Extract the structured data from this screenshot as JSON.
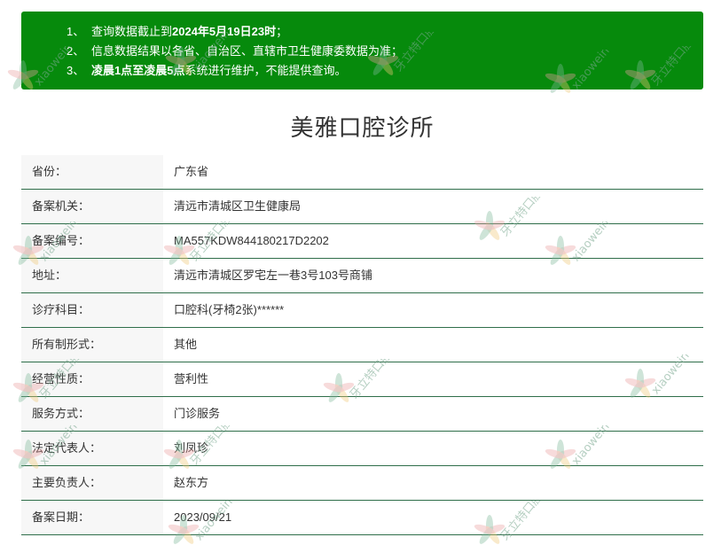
{
  "notice": {
    "line1": {
      "num": "1、",
      "pre": "查询数据截止到",
      "bold": "2024年5月19日23时",
      "post": "；"
    },
    "line2": {
      "num": "2、",
      "pre": "信息数据结果以各省、自治区、直辖市卫生健康委数据为准；",
      "bold": "",
      "post": ""
    },
    "line3": {
      "num": "3、",
      "pre": "",
      "bold": "凌晨1点至凌晨5点",
      "post": "系统进行维护，不能提供查询。"
    }
  },
  "title": "美雅口腔诊所",
  "rows": [
    {
      "label": "省份：",
      "value": "广东省"
    },
    {
      "label": "备案机关：",
      "value": "清远市清城区卫生健康局"
    },
    {
      "label": "备案编号：",
      "value": "MA557KDW844180217D2202"
    },
    {
      "label": "地址：",
      "value": "清远市清城区罗宅左一巷3号103号商铺"
    },
    {
      "label": "诊疗科目：",
      "value": "口腔科(牙椅2张)******"
    },
    {
      "label": "所有制形式：",
      "value": "其他"
    },
    {
      "label": "经营性质：",
      "value": "营利性"
    },
    {
      "label": "服务方式：",
      "value": "门诊服务"
    },
    {
      "label": "法定代表人：",
      "value": "刘凤珍"
    },
    {
      "label": "主要负责人：",
      "value": "赵东方"
    },
    {
      "label": "备案日期：",
      "value": "2023/09/21"
    }
  ],
  "watermark": {
    "brand_text": "xiaowein",
    "cn_text": "牙立特口腔",
    "leaf_colors": [
      "#7fb89a",
      "#e8a0a0",
      "#f0c878"
    ]
  }
}
